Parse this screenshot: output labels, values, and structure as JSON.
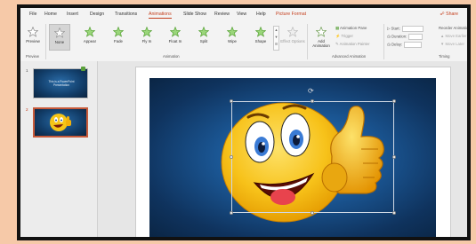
{
  "tabs": [
    "File",
    "Home",
    "Insert",
    "Design",
    "Transitions",
    "Animations",
    "Slide Show",
    "Review",
    "View",
    "Help",
    "Picture Format"
  ],
  "active_tab": "Animations",
  "share_label": "Share",
  "ribbon": {
    "preview": {
      "label": "Preview",
      "group": "Preview"
    },
    "animations": [
      {
        "label": "None",
        "selected": true
      },
      {
        "label": "Appear"
      },
      {
        "label": "Fade"
      },
      {
        "label": "Fly In"
      },
      {
        "label": "Float In"
      },
      {
        "label": "Split"
      },
      {
        "label": "Wipe"
      },
      {
        "label": "Shape"
      }
    ],
    "effect_options": "Effect Options",
    "animation_group": "Animation",
    "add_animation": "Add Animation",
    "animation_pane": "Animation Pane",
    "trigger": "Trigger",
    "animation_painter": "Animation Painter",
    "advanced_group": "Advanced Animation",
    "start": "Start:",
    "duration": "Duration:",
    "delay": "Delay:",
    "timing_group": "Timing",
    "reorder": "Reorder Animation",
    "move_earlier": "Move Earlier",
    "move_later": "Move Later"
  },
  "slides": [
    {
      "number": "1",
      "text": "This is a PowerPoint Presentation"
    },
    {
      "number": "2"
    }
  ],
  "colors": {
    "accent": "#c43e1c",
    "frame": "#f6c9a8",
    "slide_bg": "#1a5592",
    "emoji": "#f5c518"
  }
}
